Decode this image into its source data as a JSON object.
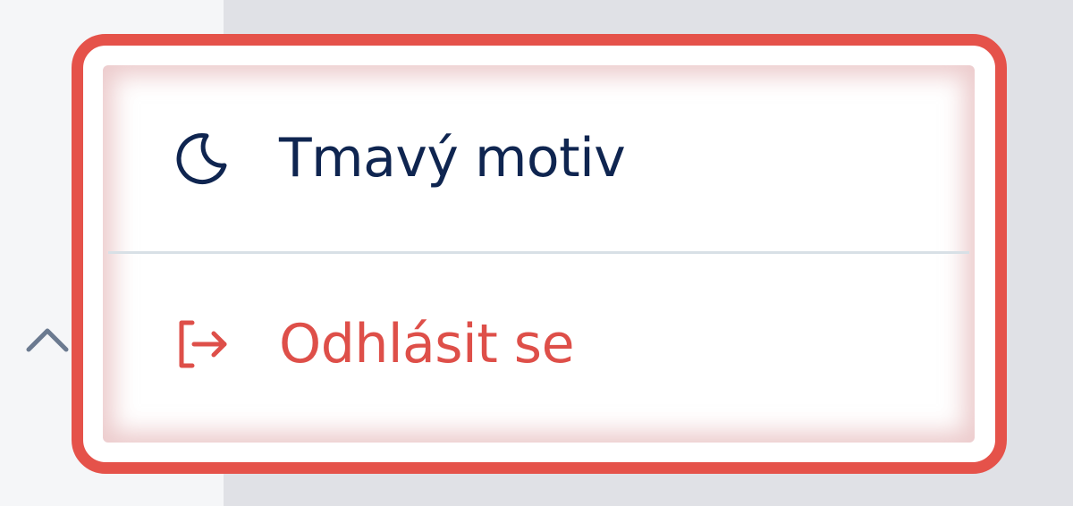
{
  "menu": {
    "items": [
      {
        "id": "theme",
        "label": "Tmavý motiv",
        "icon": "moon-icon",
        "color": "#0f2550"
      },
      {
        "id": "logout",
        "label": "Odhlásit se",
        "icon": "logout-icon",
        "color": "#de4f49"
      }
    ]
  },
  "colors": {
    "highlight_border": "#e5524a",
    "divider": "#d8e0e6",
    "chevron": "#6b7a90"
  },
  "sidebar": {
    "collapse_icon": "chevron-up-icon"
  }
}
